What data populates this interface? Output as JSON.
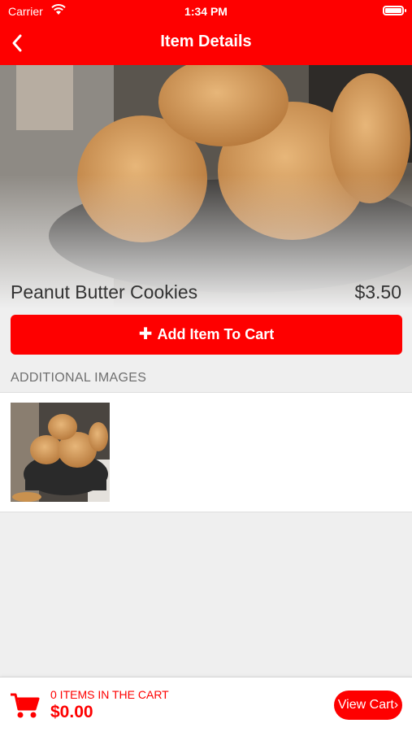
{
  "status_bar": {
    "carrier": "Carrier",
    "time": "1:34 PM"
  },
  "nav": {
    "title": "Item Details",
    "back_icon": "chevron-left-icon"
  },
  "item": {
    "name": "Peanut Butter Cookies",
    "price": "$3.50",
    "add_to_cart_label": "Add Item To Cart",
    "add_icon": "plus-icon"
  },
  "additional_images": {
    "header": "ADDITIONAL IMAGES"
  },
  "cart": {
    "count_text": "0 ITEMS IN THE CART",
    "total": "$0.00",
    "view_cart_label": "View Cart",
    "view_cart_icon": "chevron-right-icon",
    "cart_icon": "shopping-cart-icon"
  },
  "colors": {
    "accent": "#fe0000",
    "background": "#efefef",
    "text": "#333333",
    "muted": "#6f6f6f"
  }
}
